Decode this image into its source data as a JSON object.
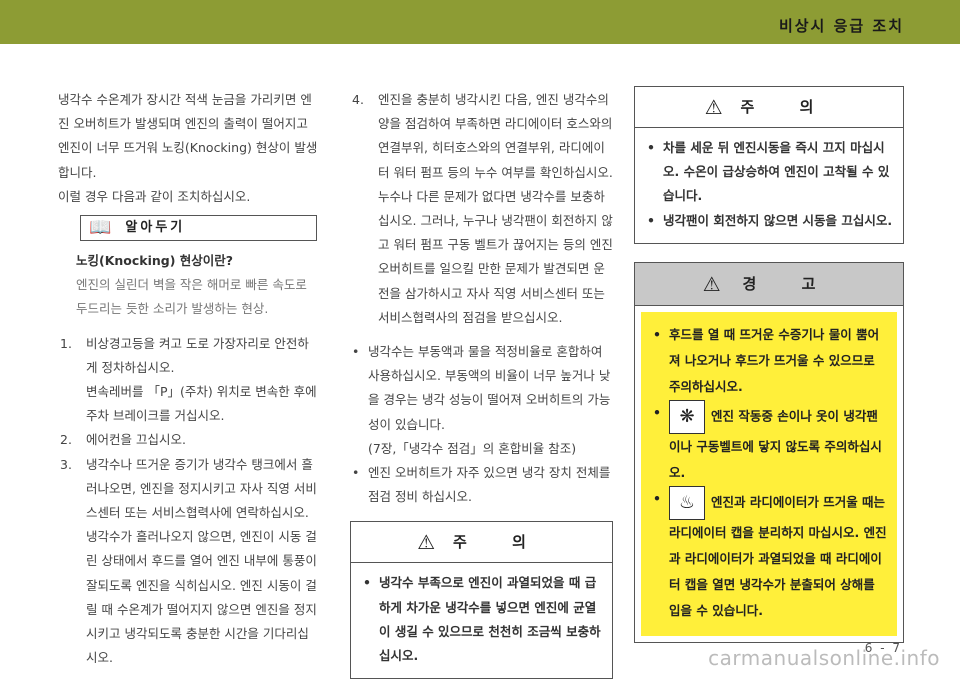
{
  "header": {
    "title": "비상시 응급 조치"
  },
  "col1": {
    "intro": "냉각수 수온계가 장시간 적색 눈금을 가리키면 엔진 오버히트가 발생되며 엔진의 출력이 떨어지고 엔진이 너무 뜨거워 노킹(Knocking) 현상이 발생합니다.",
    "intro2": "이럴 경우 다음과 같이 조치하십시오.",
    "tip_label": "알아두기",
    "tip_title": "노킹(Knocking) 현상이란?",
    "tip_text": "엔진의 실린더 벽을 작은 해머로 빠른 속도로 두드리는 듯한 소리가 발생하는 현상.",
    "steps": [
      {
        "num": "1.",
        "text": "비상경고등을 켜고 도로 가장자리로 안전하게 정차하십시오.",
        "extra": "변속레버를 「P」(주차) 위치로 변속한 후에 주차 브레이크를 거십시오."
      },
      {
        "num": "2.",
        "text": "에어컨을 끄십시오.",
        "extra": ""
      },
      {
        "num": "3.",
        "text": "냉각수나 뜨거운 증기가 냉각수 탱크에서 흘러나오면, 엔진을 정지시키고 자사 직영 서비스센터 또는 서비스협력사에 연락하십시오.",
        "extra": "냉각수가 흘러나오지 않으면, 엔진이 시동 걸린 상태에서 후드를 열어 엔진 내부에 통풍이 잘되도록 엔진을 식히십시오. 엔진 시동이 걸릴 때 수온계가 떨어지지 않으면 엔진을 정지시키고 냉각되도록 충분한 시간을 기다리십시오."
      }
    ]
  },
  "col2": {
    "step4_num": "4.",
    "step4_text": "엔진을 충분히 냉각시킨 다음, 엔진 냉각수의 양을 점검하여 부족하면 라디에이터 호스와의 연결부위, 히터호스와의 연결부위, 라디에이터 워터 펌프 등의 누수 여부를 확인하십시오.",
    "step4_text2": "누수나 다른 문제가 없다면 냉각수를 보충하십시오. 그러나, 누구나 냉각팬이 회전하지 않고 워터 펌프 구동 벨트가 끊어지는 등의 엔진 오버히트를 일으킬 만한 문제가 발견되면 운전을 삼가하시고 자사 직영 서비스센터 또는 서비스협력사의 점검을 받으십시오.",
    "bullets": [
      "냉각수는 부동액과 물을 적정비율로 혼합하여 사용하십시오. 부동액의 비율이 너무 높거나 낮을 경우는 냉각 성능이 떨어져 오버히트의 가능성이 있습니다.",
      "(7장,「냉각수 점검」의 혼합비율 참조)",
      "엔진 오버히트가 자주 있으면 냉각 장치 전체를 점검 정비 하십시오."
    ],
    "caution_title": "주 의",
    "caution_text": "냉각수 부족으로 엔진이 과열되었을 때 급하게 차가운 냉각수를 넣으면 엔진에 균열이 생길 수 있으므로 천천히 조금씩 보충하십시오."
  },
  "col3": {
    "caution_title": "주 의",
    "caution_items": [
      "차를 세운 뒤 엔진시동을 즉시 끄지 마십시오. 수온이 급상승하여 엔진이 고착될 수 있습니다.",
      "냉각팬이 회전하지 않으면 시동을 끄십시오."
    ],
    "warning_title": "경 고",
    "warning_items": [
      "후드를 열 때 뜨거운 수증기나 물이 뿜어져 나오거나 후드가 뜨거울 수 있으므로 주의하십시오.",
      "엔진 작동중 손이나 옷이 냉각팬이나 구동벨트에 닿지 않도록 주의하십시오.",
      "엔진과 라디에이터가 뜨거울 때는 라디에이터 캡을 분리하지 마십시오. 엔진과 라디에이터가 과열되었을 때 라디에이터 캡을 열면 냉각수가 분출되어 상해를 입을 수 있습니다."
    ]
  },
  "footer": {
    "page": "6 - 7",
    "watermark": "carmanualsonline.info"
  }
}
